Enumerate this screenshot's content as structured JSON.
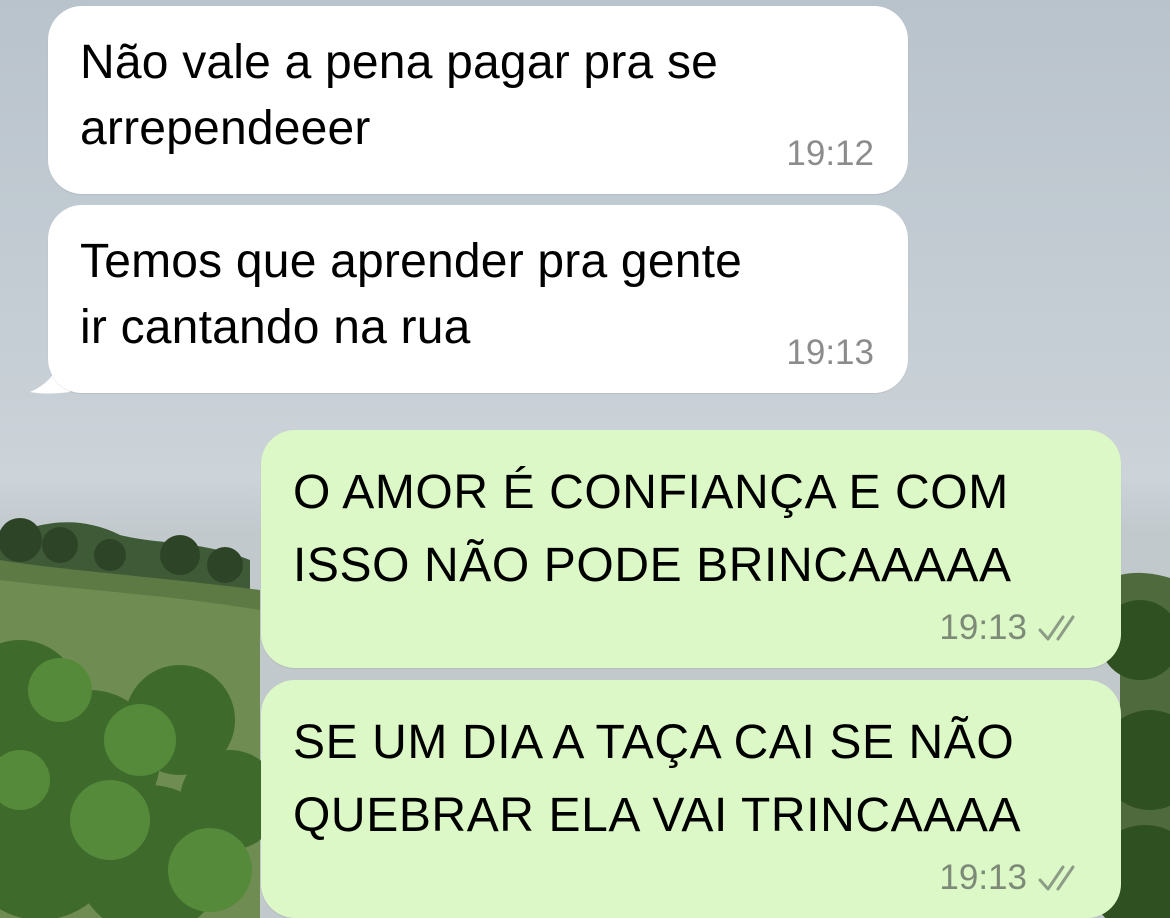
{
  "chat": {
    "messages": [
      {
        "direction": "incoming",
        "text": "Não vale a pena pagar pra se\narrependeeer",
        "time": "19:12"
      },
      {
        "direction": "incoming",
        "text": "Temos que aprender pra gente\nir cantando na rua",
        "time": "19:13"
      },
      {
        "direction": "outgoing",
        "text": "O AMOR É CONFIANÇA E COM\nISSO NÃO PODE BRINCAAAAA",
        "time": "19:13",
        "status_icon": "double-check-icon"
      },
      {
        "direction": "outgoing",
        "text": "SE UM DIA A TAÇA CAI SE NÃO\nQUEBRAR ELA VAI TRINCAAAA",
        "time": "19:13",
        "status_icon": "double-check-icon"
      }
    ]
  },
  "colors": {
    "incoming_bubble": "#ffffff",
    "outgoing_bubble": "#dcf8c6",
    "timestamp": "#8c8c8c"
  },
  "wallpaper": {
    "description_icon": "landscape-wallpaper"
  }
}
